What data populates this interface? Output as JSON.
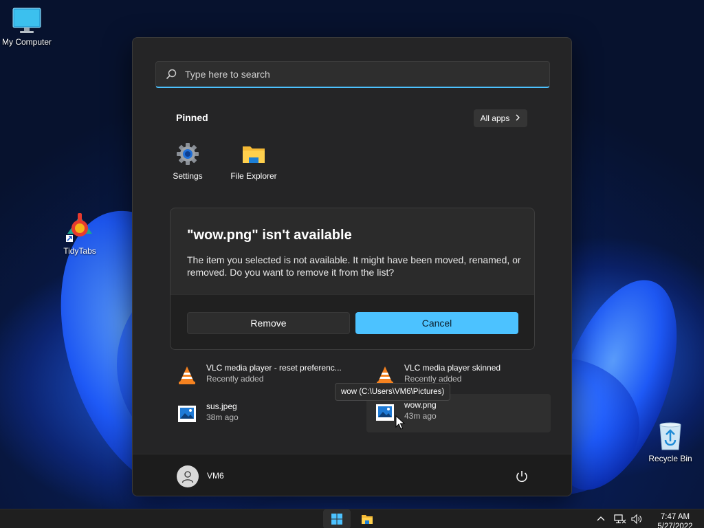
{
  "desktop": {
    "icons": [
      {
        "label": "My Computer",
        "icon": "monitor-icon"
      },
      {
        "label": "TidyTabs",
        "icon": "tidytabs-icon"
      },
      {
        "label": "Recycle Bin",
        "icon": "recycle-bin-icon"
      }
    ]
  },
  "start_menu": {
    "search": {
      "placeholder": "Type here to search",
      "value": ""
    },
    "pinned": {
      "title": "Pinned",
      "all_apps_label": "All apps",
      "apps": [
        {
          "label": "Settings",
          "icon": "gear-icon"
        },
        {
          "label": "File Explorer",
          "icon": "folder-icon"
        }
      ]
    },
    "dialog": {
      "title": "\"wow.png\" isn't available",
      "body": "The item you selected is not available. It might have been moved, renamed, or removed. Do you want to remove it from the list?",
      "remove_label": "Remove",
      "cancel_label": "Cancel"
    },
    "recommended": [
      {
        "name": "VLC media player - reset preferenc...",
        "sub": "Recently added",
        "icon": "vlc-icon"
      },
      {
        "name": "VLC media player skinned",
        "sub": "Recently added",
        "icon": "vlc-icon"
      },
      {
        "name": "sus.jpeg",
        "sub": "38m ago",
        "icon": "image-file-icon"
      },
      {
        "name": "wow.png",
        "sub": "43m ago",
        "icon": "image-file-icon"
      }
    ],
    "tooltip": "wow (C:\\Users\\VM6\\Pictures)",
    "user": {
      "name": "VM6"
    }
  },
  "taskbar": {
    "clock_time": "7:47 AM",
    "clock_date": "5/27/2022"
  },
  "colors": {
    "accent": "#4cc2ff",
    "menu_bg": "#252526",
    "taskbar_bg": "#1f1f1f"
  }
}
